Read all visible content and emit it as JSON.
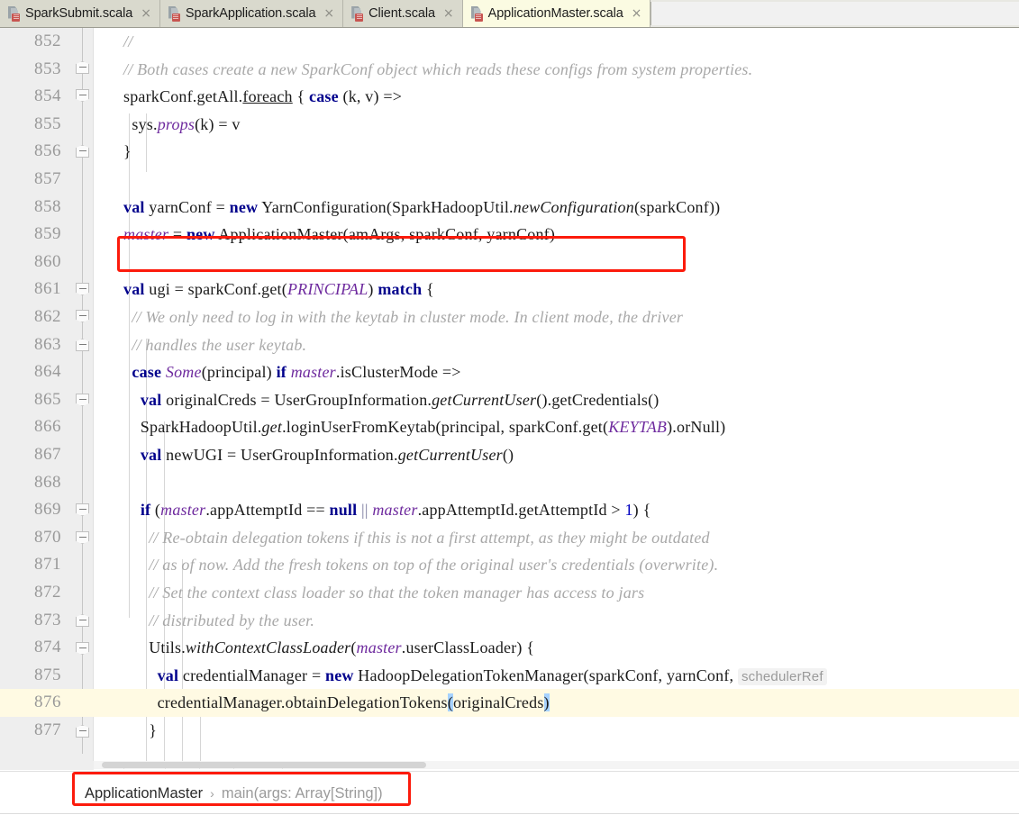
{
  "window": {
    "app": "IntelliJ IDEA Editor",
    "active_tab_bg": "#fbfbe2",
    "accent_annotation": "#fc1b0c"
  },
  "tabs": [
    {
      "label": "SparkSubmit.scala",
      "icon": "scala-object-icon",
      "close": "×",
      "active": false
    },
    {
      "label": "SparkApplication.scala",
      "icon": "scala-object-icon",
      "close": "×",
      "active": false
    },
    {
      "label": "Client.scala",
      "icon": "scala-object-icon",
      "close": "×",
      "active": false
    },
    {
      "label": "ApplicationMaster.scala",
      "icon": "scala-object-icon",
      "close": "×",
      "active": true
    }
  ],
  "editor": {
    "first_line": 852,
    "current_line": 876,
    "lines": [
      {
        "n": "852",
        "text": "    //"
      },
      {
        "n": "853",
        "text": "    // Both cases create a new SparkConf object which reads these configs from system properties."
      },
      {
        "n": "854",
        "text": "    sparkConf.getAll.foreach { case (k, v) =>"
      },
      {
        "n": "855",
        "text": "      sys.props(k) = v"
      },
      {
        "n": "856",
        "text": "    }"
      },
      {
        "n": "857",
        "text": ""
      },
      {
        "n": "858",
        "text": "    val yarnConf = new YarnConfiguration(SparkHadoopUtil.newConfiguration(sparkConf))"
      },
      {
        "n": "859",
        "text": "    master = new ApplicationMaster(amArgs, sparkConf, yarnConf)"
      },
      {
        "n": "860",
        "text": ""
      },
      {
        "n": "861",
        "text": "    val ugi = sparkConf.get(PRINCIPAL) match {"
      },
      {
        "n": "862",
        "text": "      // We only need to log in with the keytab in cluster mode. In client mode, the driver"
      },
      {
        "n": "863",
        "text": "      // handles the user keytab."
      },
      {
        "n": "864",
        "text": "      case Some(principal) if master.isClusterMode =>"
      },
      {
        "n": "865",
        "text": "        val originalCreds = UserGroupInformation.getCurrentUser().getCredentials()"
      },
      {
        "n": "866",
        "text": "        SparkHadoopUtil.get.loginUserFromKeytab(principal, sparkConf.get(KEYTAB).orNull)"
      },
      {
        "n": "867",
        "text": "        val newUGI = UserGroupInformation.getCurrentUser()"
      },
      {
        "n": "868",
        "text": ""
      },
      {
        "n": "869",
        "text": "        if (master.appAttemptId == null || master.appAttemptId.getAttemptId > 1) {"
      },
      {
        "n": "870",
        "text": "          // Re-obtain delegation tokens if this is not a first attempt, as they might be outdated"
      },
      {
        "n": "871",
        "text": "          // as of now. Add the fresh tokens on top of the original user's credentials (overwrite)."
      },
      {
        "n": "872",
        "text": "          // Set the context class loader so that the token manager has access to jars"
      },
      {
        "n": "873",
        "text": "          // distributed by the user."
      },
      {
        "n": "874",
        "text": "          Utils.withContextClassLoader(master.userClassLoader) {"
      },
      {
        "n": "875",
        "text": "            val credentialManager = new HadoopDelegationTokenManager(sparkConf, yarnConf, schedulerRef"
      },
      {
        "n": "876",
        "text": "            credentialManager.obtainDelegationTokens(originalCreds)"
      },
      {
        "n": "877",
        "text": "          }"
      }
    ],
    "inline_hint": "schedulerRef",
    "selection_text": "(originalCreds)"
  },
  "breadcrumb": {
    "root": "ApplicationMaster",
    "separator": "›",
    "member": "main(args: Array[String])"
  }
}
